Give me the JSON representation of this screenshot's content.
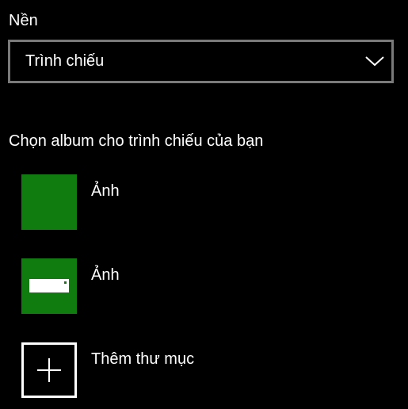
{
  "background": {
    "title": "Nền",
    "dropdown": {
      "selected": "Trình chiếu",
      "icon": "chevron-down-icon"
    }
  },
  "slideshow": {
    "heading": "Chọn album cho trình chiếu của bạn",
    "albums": [
      {
        "label": "Ảnh",
        "icon": "folder-thumbnail"
      },
      {
        "label": "Ảnh",
        "icon": "drive-icon"
      }
    ],
    "add_folder": {
      "label": "Thêm thư mục",
      "icon": "plus-icon"
    }
  },
  "colors": {
    "accent": "#107c10",
    "border": "#7a7a7a",
    "background": "#000000",
    "text": "#ffffff"
  }
}
